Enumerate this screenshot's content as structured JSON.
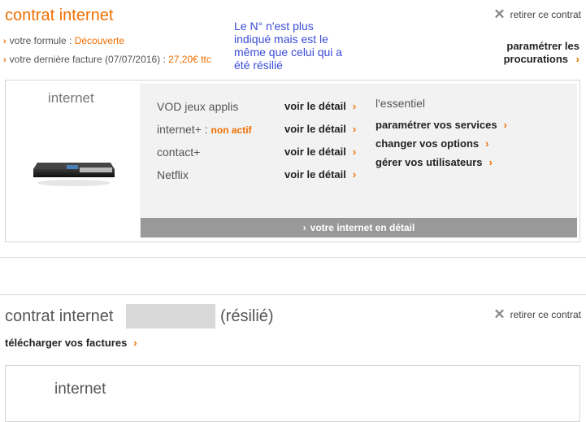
{
  "contract1": {
    "title": "contrat internet",
    "formula_label": "votre formule : ",
    "formula_value": "Découverte",
    "invoice_label": "votre dernière facture (07/07/2016) : ",
    "invoice_value": "27,20€ ttc",
    "remove_label": "retirer ce contrat",
    "procurations_line1": "paramétrer les",
    "procurations_line2": "procurations",
    "note": "Le N° n'est plus indiqué mais est le même que celui qui a été résilié",
    "card_label": "internet",
    "services": [
      {
        "name": "VOD jeux applis",
        "status": "",
        "link": "voir le détail"
      },
      {
        "name": "internet+ : ",
        "status": "non actif",
        "link": "voir le détail"
      },
      {
        "name": "contact+",
        "status": "",
        "link": "voir le détail"
      },
      {
        "name": "Netflix",
        "status": "",
        "link": "voir le détail"
      }
    ],
    "essentials_title": "l'essentiel",
    "essentials": [
      "paramétrer vos services",
      "changer vos options",
      "gérer vos utilisateurs"
    ],
    "detail_bar": "votre internet en détail"
  },
  "contract2": {
    "title": "contrat internet",
    "status": "(résilié)",
    "remove_label": "retirer ce contrat",
    "download_label": "télécharger vos factures",
    "card_label": "internet"
  },
  "icons": {
    "chevron": "chevron-right-icon",
    "remove": "close-icon",
    "bullet": "bullet-chevron-icon",
    "device": "livebox-device-icon"
  },
  "colors": {
    "accent": "#f16e00",
    "note_text": "#3b4bd8",
    "panel_bg": "#f2f2f2",
    "bar_bg": "#999999"
  }
}
